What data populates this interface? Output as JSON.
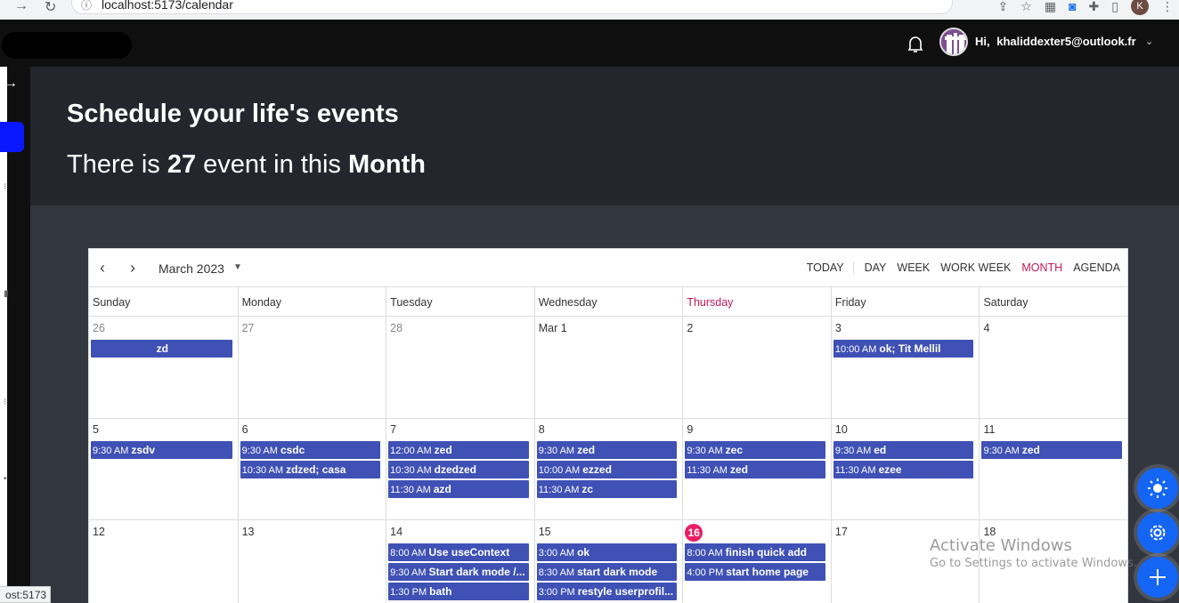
{
  "browser": {
    "url": "localhost:5173/calendar",
    "profile_initial": "K",
    "status_url": "ost:5173"
  },
  "header": {
    "greeting": "Hi,",
    "user_email": "khaliddexter5@outlook.fr"
  },
  "hero": {
    "title": "Schedule your life's events",
    "sub_prefix": "There is",
    "event_count": "27",
    "sub_middle": "event in this",
    "sub_suffix": "Month"
  },
  "calendar": {
    "month_label": "March 2023",
    "views": [
      "TODAY",
      "DAY",
      "WEEK",
      "WORK WEEK",
      "MONTH",
      "AGENDA"
    ],
    "active_view": "MONTH",
    "day_headers": [
      "Sunday",
      "Monday",
      "Tuesday",
      "Wednesday",
      "Thursday",
      "Friday",
      "Saturday"
    ],
    "weeks": [
      {
        "days": [
          {
            "label": "26",
            "off": true,
            "events": [
              {
                "time": "",
                "title": "zd",
                "allday": true
              }
            ]
          },
          {
            "label": "27",
            "off": true,
            "events": []
          },
          {
            "label": "28",
            "off": true,
            "events": []
          },
          {
            "label": "Mar 1",
            "events": []
          },
          {
            "label": "2",
            "events": []
          },
          {
            "label": "3",
            "events": [
              {
                "time": "10:00 AM",
                "title": "ok; Tit Mellil"
              }
            ]
          },
          {
            "label": "4",
            "events": []
          }
        ]
      },
      {
        "days": [
          {
            "label": "5",
            "events": [
              {
                "time": "9:30 AM",
                "title": "zsdv"
              }
            ]
          },
          {
            "label": "6",
            "events": [
              {
                "time": "9:30 AM",
                "title": "csdc"
              },
              {
                "time": "10:30 AM",
                "title": "zdzed; casa"
              }
            ]
          },
          {
            "label": "7",
            "events": [
              {
                "time": "12:00 AM",
                "title": "zed"
              },
              {
                "time": "10:30 AM",
                "title": "dzedzed"
              },
              {
                "time": "11:30 AM",
                "title": "azd"
              }
            ]
          },
          {
            "label": "8",
            "events": [
              {
                "time": "9:30 AM",
                "title": "zed"
              },
              {
                "time": "10:00 AM",
                "title": "ezzed"
              },
              {
                "time": "11:30 AM",
                "title": "zc"
              }
            ]
          },
          {
            "label": "9",
            "events": [
              {
                "time": "9:30 AM",
                "title": "zec"
              },
              {
                "time": "11:30 AM",
                "title": "zed"
              }
            ]
          },
          {
            "label": "10",
            "events": [
              {
                "time": "9:30 AM",
                "title": "ed"
              },
              {
                "time": "11:30 AM",
                "title": "ezee"
              }
            ]
          },
          {
            "label": "11",
            "events": [
              {
                "time": "9:30 AM",
                "title": "zed"
              }
            ]
          }
        ]
      },
      {
        "days": [
          {
            "label": "12",
            "events": []
          },
          {
            "label": "13",
            "events": []
          },
          {
            "label": "14",
            "events": [
              {
                "time": "8:00 AM",
                "title": "Use useContext"
              },
              {
                "time": "9:30 AM",
                "title": "Start dark mode /..."
              },
              {
                "time": "1:30 PM",
                "title": "bath"
              }
            ]
          },
          {
            "label": "15",
            "events": [
              {
                "time": "3:00 AM",
                "title": "ok"
              },
              {
                "time": "8:30 AM",
                "title": "start dark mode"
              },
              {
                "time": "3:00 PM",
                "title": "restyle userprofil..."
              }
            ]
          },
          {
            "label": "16",
            "today": true,
            "events": [
              {
                "time": "8:00 AM",
                "title": "finish quick add"
              },
              {
                "time": "4:00 PM",
                "title": "start home page"
              }
            ]
          },
          {
            "label": "17",
            "events": []
          },
          {
            "label": "18",
            "events": []
          }
        ]
      }
    ]
  },
  "watermark": {
    "line1": "Activate Windows",
    "line2": "Go to Settings to activate Windows."
  },
  "colors": {
    "event": "#3f51b5",
    "accent": "#c2185b",
    "today_badge": "#e91e63",
    "fab": "#1565f5"
  }
}
